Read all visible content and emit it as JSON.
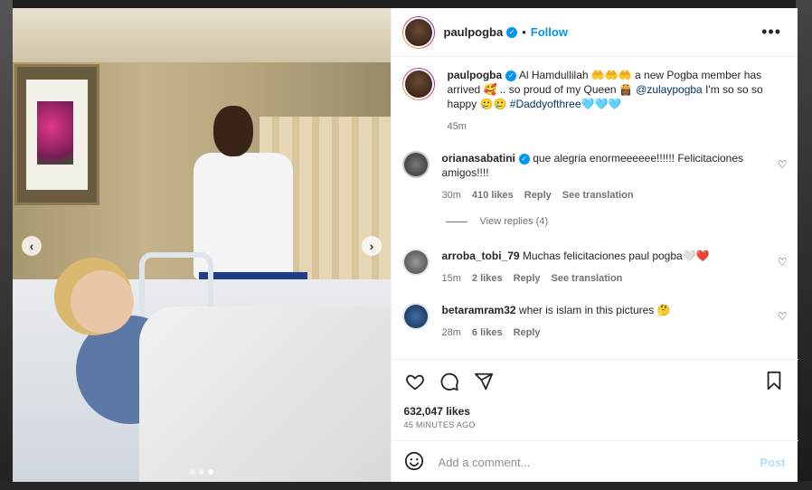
{
  "post": {
    "username": "paulpogba",
    "follow_label": "Follow",
    "dot": "•",
    "more_icon": "ellipsis-icon",
    "caption": {
      "username": "paulpogba",
      "text_part1": "Al Hamdullilah 🤲🤲🤲 a new Pogba member has arrived 🥰 .. so proud of my Queen 👸🏾 ",
      "mention": "@zulaypogba",
      "text_part2": " I'm so so so happy 🥲🥲 ",
      "hashtag": "#Daddyofthree",
      "hearts": "🩵🩵🩵",
      "time": "45m"
    },
    "comments": [
      {
        "username": "orianasabatini",
        "verified": true,
        "text": "que alegria enormeeeeee!!!!!! Felicitaciones amigos!!!!",
        "time": "30m",
        "likes": "410 likes",
        "reply": "Reply",
        "translate": "See translation",
        "view_replies": "View replies (4)"
      },
      {
        "username": "arroba_tobi_79",
        "verified": false,
        "text": "Muchas felicitaciones paul pogba🤍❤️",
        "time": "15m",
        "likes": "2 likes",
        "reply": "Reply",
        "translate": "See translation"
      },
      {
        "username": "betaramram32",
        "verified": false,
        "text": "wher is islam in this pictures 🤔",
        "time": "28m",
        "likes": "6 likes",
        "reply": "Reply"
      }
    ],
    "likes": "632,047 likes",
    "time_ago": "45 MINUTES AGO",
    "add_comment_placeholder": "Add a comment...",
    "post_label": "Post",
    "carousel": {
      "count": 3,
      "active": 2
    }
  },
  "colors": {
    "accent": "#0095f6",
    "text": "#262626",
    "muted": "#737373",
    "post_disabled": "#b2dffc"
  }
}
